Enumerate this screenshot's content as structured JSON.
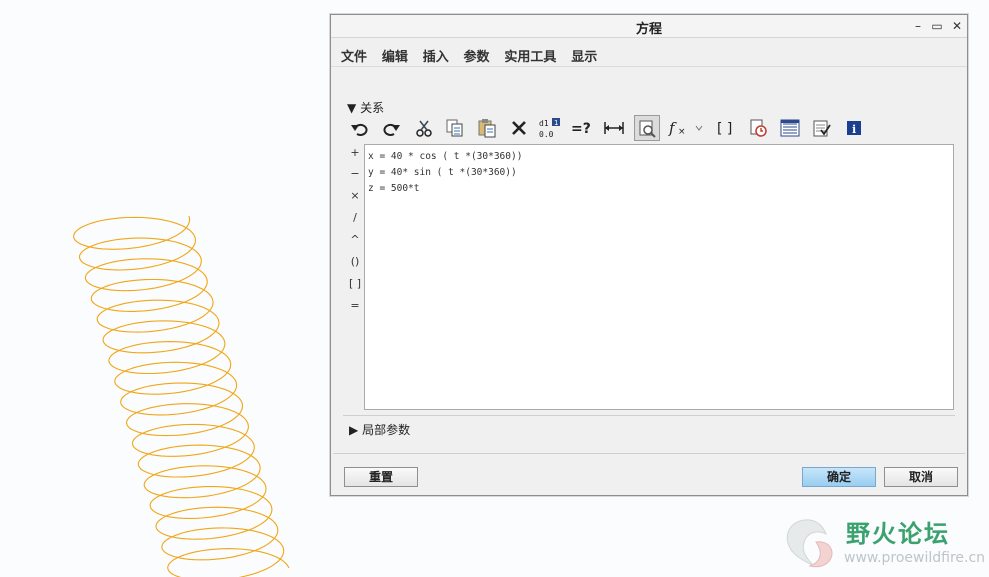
{
  "dialog": {
    "title": "方程",
    "window_controls": [
      "minimize-icon",
      "maximize-icon",
      "close-icon"
    ]
  },
  "menu": [
    "文件",
    "编辑",
    "插入",
    "参数",
    "实用工具",
    "显示"
  ],
  "relations_section": {
    "label": "关系"
  },
  "toolbar_icons": [
    "undo-icon",
    "redo-icon",
    "cut-icon",
    "copy-icon",
    "paste-icon",
    "delete-icon",
    "sort-icon",
    "evaluate-icon",
    "dimension-icon",
    "display-icon",
    "function-icon",
    "function-dropdown-icon",
    "brackets-icon",
    "verify-icon",
    "params-icon",
    "units-icon",
    "info-icon"
  ],
  "operators": [
    "+",
    "−",
    "×",
    "/",
    "^",
    "()",
    "[ ]",
    "="
  ],
  "editor": {
    "lines": [
      "x = 40 * cos ( t *(30*360))",
      "y = 40* sin ( t *(30*360))",
      "z = 500*t"
    ]
  },
  "local_params": {
    "label": "局部参数"
  },
  "buttons": {
    "reset": "重置",
    "ok": "确定",
    "cancel": "取消"
  },
  "watermark": {
    "name": "野火论坛",
    "url": "www.proewildfire.cn"
  },
  "colors": {
    "spring": "#f0a617",
    "accent_button": "#a8d6f4",
    "logo_green": "#3aa26f"
  }
}
